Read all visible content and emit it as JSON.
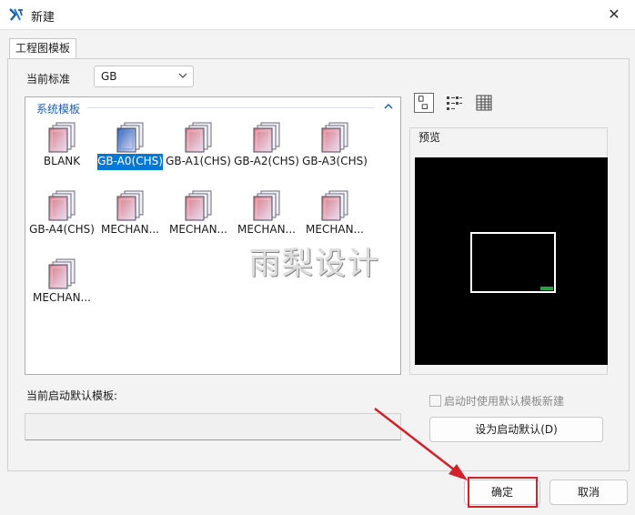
{
  "window": {
    "title": "新建"
  },
  "tabs": [
    {
      "label": "工程图模板",
      "active": true
    }
  ],
  "standard": {
    "label": "当前标准",
    "value": "GB"
  },
  "templates": {
    "group_label": "系统模板",
    "items": [
      {
        "label": "BLANK",
        "selected": false
      },
      {
        "label": "GB-A0(CHS)",
        "selected": true
      },
      {
        "label": "GB-A1(CHS)",
        "selected": false
      },
      {
        "label": "GB-A2(CHS)",
        "selected": false
      },
      {
        "label": "GB-A3(CHS)",
        "selected": false
      },
      {
        "label": "GB-A4(CHS)",
        "selected": false
      },
      {
        "label": "MECHAN...",
        "selected": false
      },
      {
        "label": "MECHAN...",
        "selected": false
      },
      {
        "label": "MECHAN...",
        "selected": false
      },
      {
        "label": "MECHAN...",
        "selected": false
      },
      {
        "label": "MECHAN...",
        "selected": false
      }
    ]
  },
  "view_modes": [
    {
      "name": "large-icons-view-icon",
      "active": true
    },
    {
      "name": "list-view-icon",
      "active": false
    },
    {
      "name": "details-view-icon",
      "active": false
    }
  ],
  "preview": {
    "label": "预览"
  },
  "default_template": {
    "label": "当前启动默认模板:",
    "value": ""
  },
  "startup_checkbox": {
    "label": "启动时使用默认模板新建",
    "checked": false,
    "enabled": false
  },
  "buttons": {
    "set_default": "设为启动默认(D)",
    "ok": "确定",
    "cancel": "取消"
  },
  "watermark": "雨梨设计",
  "colors": {
    "selection": "#0078d7",
    "group_header": "#1f5fb8",
    "annotation": "#d1222b",
    "preview_bg": "#000000"
  }
}
